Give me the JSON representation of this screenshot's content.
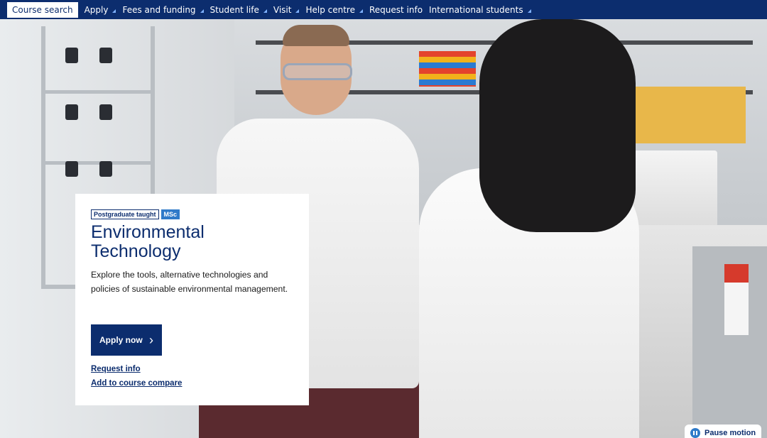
{
  "nav": {
    "search_label": "Course search",
    "items": [
      {
        "label": "Apply",
        "has_submenu": true
      },
      {
        "label": "Fees and funding",
        "has_submenu": true
      },
      {
        "label": "Student life",
        "has_submenu": true
      },
      {
        "label": "Visit",
        "has_submenu": true
      },
      {
        "label": "Help centre",
        "has_submenu": true
      },
      {
        "label": "Request info",
        "has_submenu": false
      },
      {
        "label": "International students",
        "has_submenu": true
      }
    ]
  },
  "hero": {
    "image": "lab-photo"
  },
  "card": {
    "tag_level": "Postgraduate taught",
    "tag_degree": "MSc",
    "title": "Environmental Technology",
    "description": "Explore the tools, alternative technologies and policies of sustainable environmental management.",
    "apply_label": "Apply now",
    "request_info_label": "Request info",
    "compare_label": "Add to course compare"
  },
  "motion": {
    "pause_label": "Pause motion"
  },
  "colors": {
    "navy": "#0c2d6e",
    "accent_blue": "#2f7ac9",
    "caret": "#7fb2ff"
  }
}
